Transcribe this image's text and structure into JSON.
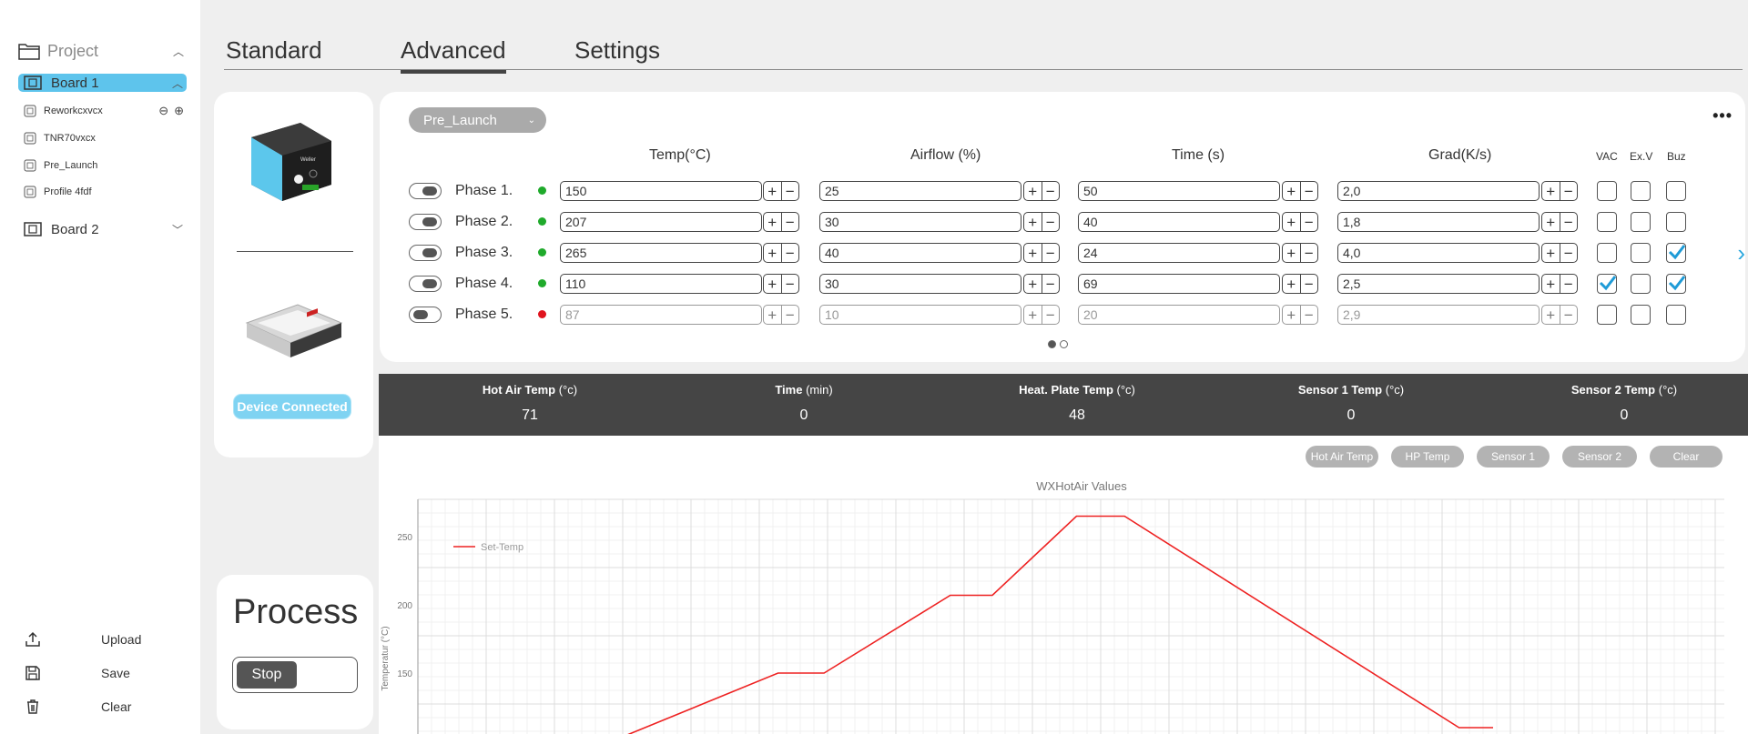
{
  "sidebar": {
    "project_label": "Project",
    "boards": [
      {
        "label": "Board 1",
        "expanded": true
      },
      {
        "label": "Board 2",
        "expanded": false
      }
    ],
    "profiles": [
      "Reworkcxvcx",
      "TNR70vxcx",
      "Pre_Launch",
      "Profile 4fdf"
    ],
    "actions": [
      {
        "label": "Upload",
        "icon": "upload-icon"
      },
      {
        "label": "Save",
        "icon": "save-icon"
      },
      {
        "label": "Clear",
        "icon": "trash-icon"
      }
    ]
  },
  "tabs": [
    "Standard",
    "Advanced",
    "Settings"
  ],
  "active_tab": "Advanced",
  "device": {
    "status": "Device Connected"
  },
  "process": {
    "title": "Process",
    "stop_label": "Stop"
  },
  "phases": {
    "profile": "Pre_Launch",
    "headers": {
      "temp": "Temp(°C)",
      "airflow": "Airflow (%)",
      "time": "Time (s)",
      "grad": "Grad(K/s)",
      "vac": "VAC",
      "exv": "Ex.V",
      "buz": "Buz"
    },
    "rows": [
      {
        "name": "Phase 1.",
        "enabled": true,
        "status": "green",
        "temp": "150",
        "airflow": "25",
        "time": "50",
        "grad": "2,0",
        "vac": false,
        "exv": false,
        "buz": false
      },
      {
        "name": "Phase 2.",
        "enabled": true,
        "status": "green",
        "temp": "207",
        "airflow": "30",
        "time": "40",
        "grad": "1,8",
        "vac": false,
        "exv": false,
        "buz": false
      },
      {
        "name": "Phase 3.",
        "enabled": true,
        "status": "green",
        "temp": "265",
        "airflow": "40",
        "time": "24",
        "grad": "4,0",
        "vac": false,
        "exv": false,
        "buz": true
      },
      {
        "name": "Phase 4.",
        "enabled": true,
        "status": "green",
        "temp": "110",
        "airflow": "30",
        "time": "69",
        "grad": "2,5",
        "vac": true,
        "exv": false,
        "buz": true
      },
      {
        "name": "Phase 5.",
        "enabled": false,
        "status": "red",
        "temp": "87",
        "airflow": "10",
        "time": "20",
        "grad": "2,9",
        "vac": false,
        "exv": false,
        "buz": false
      }
    ],
    "page": 1,
    "page_count": 2
  },
  "colors": {
    "accent": "#5ec4ec",
    "status_green": "#1faa2b",
    "status_red": "#e0141e",
    "check": "#1e9bd7",
    "series": "#ee2222"
  },
  "live": [
    {
      "label": "Hot Air Temp",
      "unit": "(°c)",
      "value": "71"
    },
    {
      "label": "Time",
      "unit": "(min)",
      "value": "0"
    },
    {
      "label": "Heat. Plate Temp",
      "unit": "(°c)",
      "value": "48"
    },
    {
      "label": "Sensor 1 Temp",
      "unit": "(°c)",
      "value": "0"
    },
    {
      "label": "Sensor 2 Temp",
      "unit": "(°c)",
      "value": "0"
    }
  ],
  "chart_buttons": [
    "Hot Air Temp",
    "HP Temp",
    "Sensor 1",
    "Sensor 2",
    "Clear"
  ],
  "chart_data": {
    "type": "line",
    "title": "WXHotAir Values",
    "ylabel": "Temperatur (°C)",
    "xlabel": "",
    "ylim": [
      95,
      270
    ],
    "yticks": [
      150,
      200,
      250
    ],
    "grid": true,
    "legend_position": "top-left",
    "series": [
      {
        "name": "Set-Temp",
        "x": [
          0,
          1,
          2,
          3,
          4,
          5,
          6,
          7,
          8,
          9,
          10,
          11,
          12
        ],
        "y": [
          95,
          150,
          150,
          207,
          207,
          265,
          265,
          110,
          110,
          110,
          110,
          110,
          110
        ]
      }
    ],
    "points": [
      [
        0,
        82
      ],
      [
        113,
        150
      ],
      [
        136,
        150
      ],
      [
        199,
        207
      ],
      [
        220,
        207
      ],
      [
        262,
        265
      ],
      [
        286,
        265
      ],
      [
        453,
        110
      ],
      [
        470,
        110
      ]
    ]
  }
}
